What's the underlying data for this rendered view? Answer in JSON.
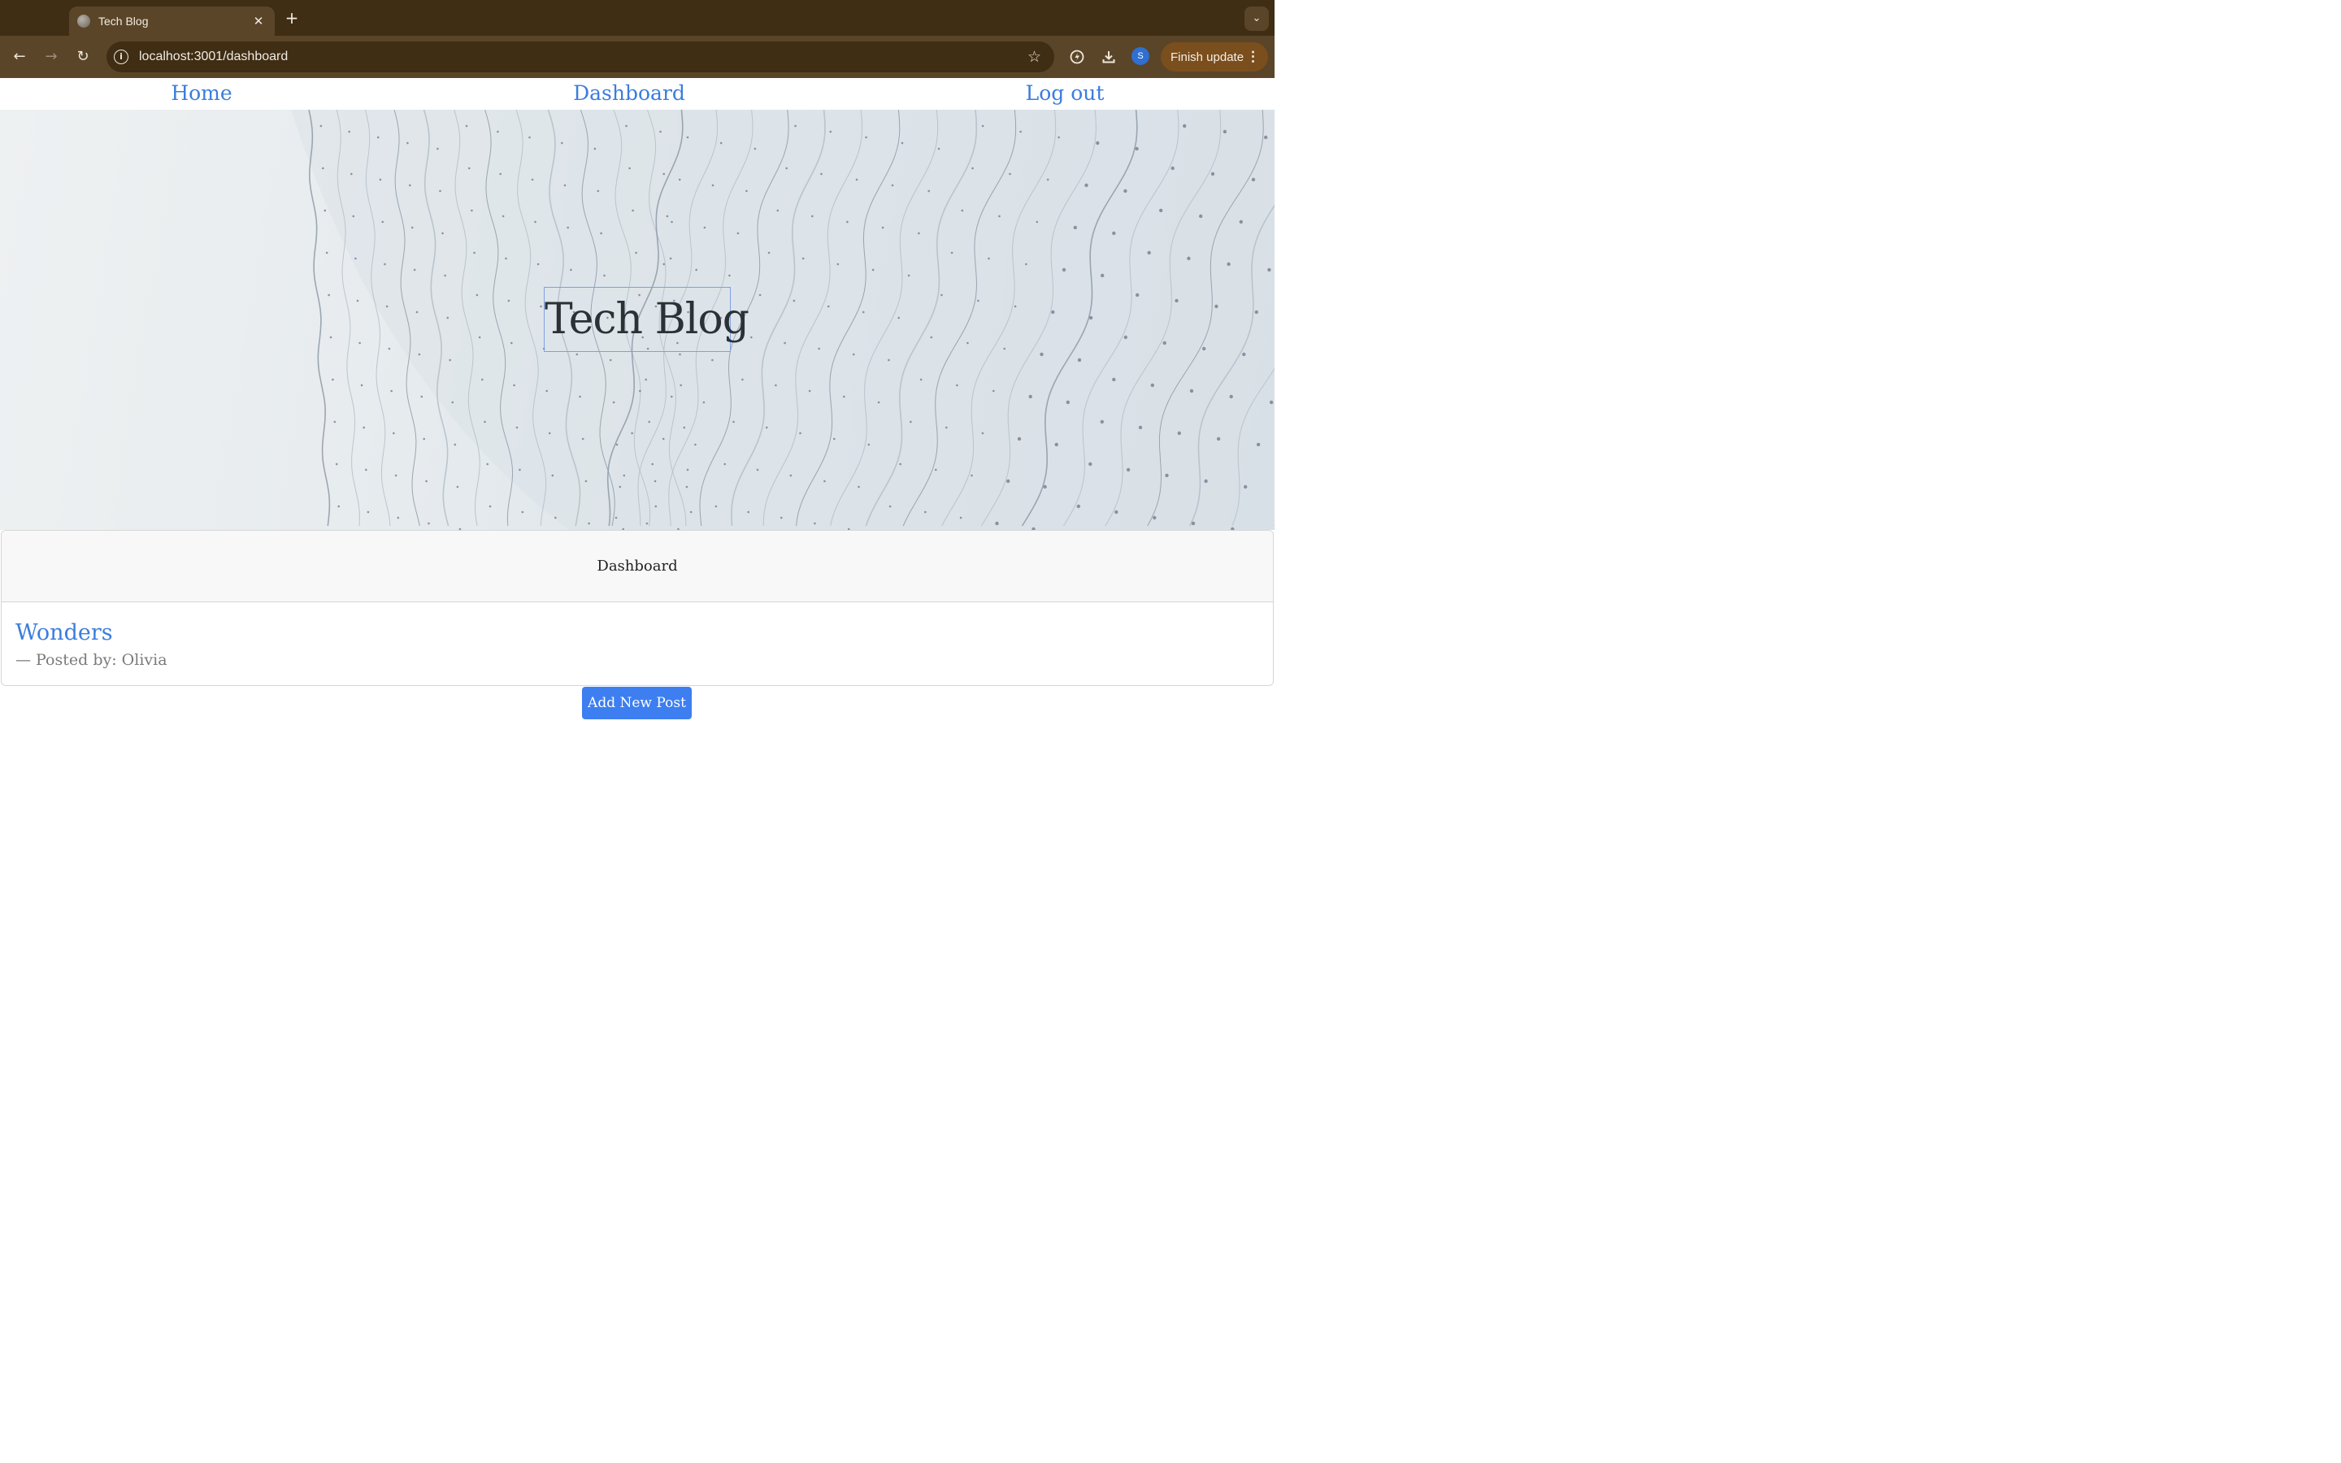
{
  "browser": {
    "tab_title": "Tech Blog",
    "tab_close": "✕",
    "new_tab": "+",
    "tab_search": "⌄",
    "back": "←",
    "forward": "→",
    "reload": "↻",
    "site_info": "i",
    "url": "localhost:3001/dashboard",
    "bookmark": "☆",
    "profile_initial": "S",
    "update_label": "Finish update",
    "update_menu": "⋮"
  },
  "nav": {
    "home": "Home",
    "dashboard": "Dashboard",
    "logout": "Log out"
  },
  "hero": {
    "title": "Tech Blog"
  },
  "dashboard": {
    "header": "Dashboard",
    "posts": [
      {
        "title": "Wonders",
        "meta": "— Posted by: Olivia"
      }
    ],
    "add_button": "Add New Post"
  },
  "colors": {
    "link": "#3b7ddd",
    "button": "#3d7ef0",
    "chrome_dark": "#3f2d14",
    "chrome_light": "#5a4528"
  }
}
